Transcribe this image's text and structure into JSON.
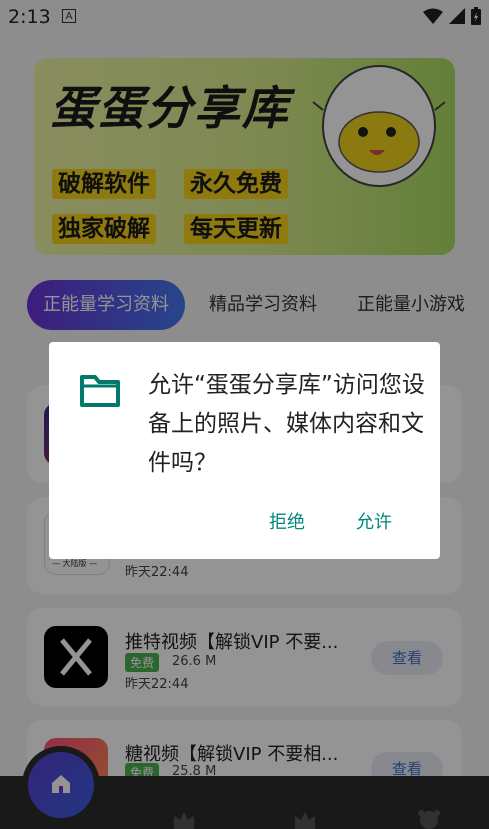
{
  "status_bar": {
    "time": "2:13",
    "notif_icon_letter": "A"
  },
  "banner": {
    "title": "蛋蛋分享库",
    "tags": [
      "破解软件",
      "永久免费",
      "独家破解",
      "每天更新"
    ]
  },
  "tabs": [
    {
      "label": "正能量学习资料",
      "active": true
    },
    {
      "label": "精品学习资料",
      "active": false
    },
    {
      "label": "正能量小游戏",
      "active": false
    }
  ],
  "list": [
    {
      "name": "推特视频【解锁VIP 不要...",
      "badge": "免费",
      "size": "26.6 M",
      "date": "昨天22:44",
      "button": "查看"
    },
    {
      "name": "糖视频【解锁VIP 不要相...",
      "badge": "免费",
      "size": "25.8 M",
      "button": "查看"
    }
  ],
  "partial_item": {
    "icon_caption": "— 大陆版 —",
    "date": "昨天22:44"
  },
  "dialog": {
    "message": "允许“蛋蛋分享库”访问您设备上的照片、媒体内容和文件吗？",
    "deny_label": "拒绝",
    "allow_label": "允许",
    "accent_color": "#00897b"
  },
  "colors": {
    "tab_gradient_start": "#6a32d8",
    "tab_gradient_end": "#4479f0",
    "free_badge": "#4caf50"
  }
}
